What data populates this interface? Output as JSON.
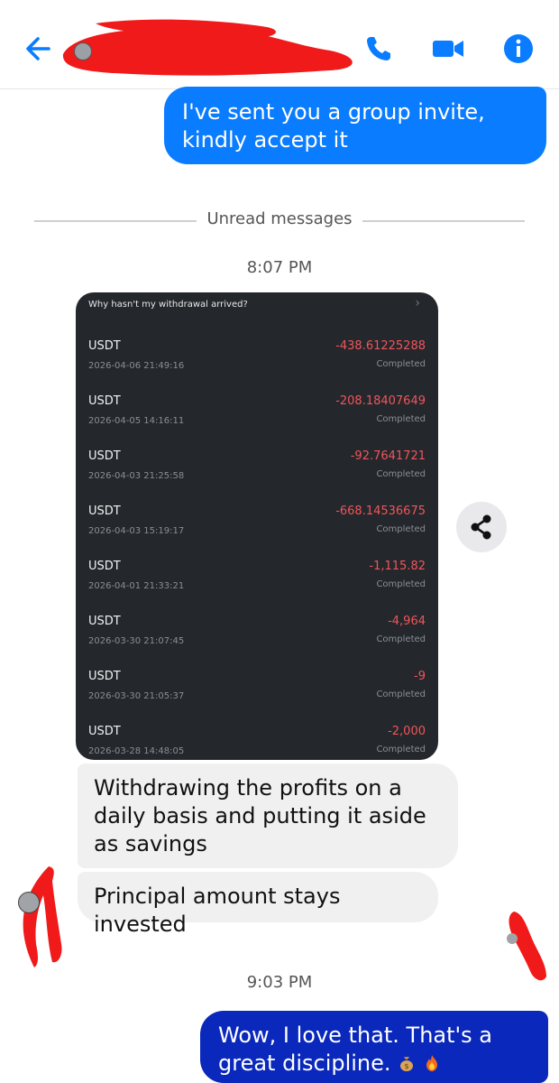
{
  "header": {
    "back_icon": "arrow-left-icon",
    "actions": [
      {
        "name": "phone-icon"
      },
      {
        "name": "video-camera-icon"
      },
      {
        "name": "info-icon"
      }
    ],
    "accent": "#0a7cff"
  },
  "messages": {
    "outgoing_1": "I've sent you a group invite, kindly accept it",
    "divider": "Unread messages",
    "time_1": "8:07 PM",
    "incoming_1": "Withdrawing the profits on a daily basis and putting it aside as savings",
    "incoming_2": "Principal amount stays invested",
    "time_2": "9:03 PM",
    "outgoing_2": "Wow, I love that. That's a great discipline."
  },
  "screenshot": {
    "heading": "Why hasn't my withdrawal arrived?",
    "transactions": [
      {
        "currency": "USDT",
        "date": "2026-04-06 21:49:16",
        "amount": "-438.61225288",
        "status": "Completed"
      },
      {
        "currency": "USDT",
        "date": "2026-04-05 14:16:11",
        "amount": "-208.18407649",
        "status": "Completed"
      },
      {
        "currency": "USDT",
        "date": "2026-04-03 21:25:58",
        "amount": "-92.7641721",
        "status": "Completed"
      },
      {
        "currency": "USDT",
        "date": "2026-04-03 15:19:17",
        "amount": "-668.14536675",
        "status": "Completed"
      },
      {
        "currency": "USDT",
        "date": "2026-04-01 21:33:21",
        "amount": "-1,115.82",
        "status": "Completed"
      },
      {
        "currency": "USDT",
        "date": "2026-03-30 21:07:45",
        "amount": "-4,964",
        "status": "Completed"
      },
      {
        "currency": "USDT",
        "date": "2026-03-30 21:05:37",
        "amount": "-9",
        "status": "Completed"
      },
      {
        "currency": "USDT",
        "date": "2026-03-28 14:48:05",
        "amount": "-2,000",
        "status": "Completed"
      }
    ],
    "amount_color": "#f0565a"
  },
  "share_icon": "share-icon",
  "emojis": [
    "money-bag-icon",
    "fire-icon"
  ]
}
